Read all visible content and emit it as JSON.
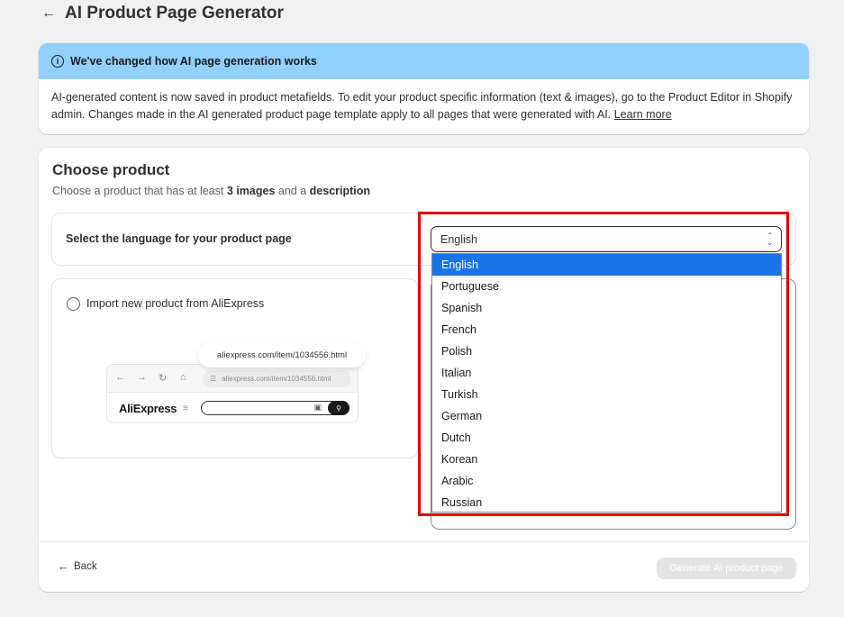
{
  "header": {
    "back_icon": "arrow-left-icon",
    "title": "AI Product Page Generator"
  },
  "banner": {
    "title": "We've changed how AI page generation works",
    "body": "AI-generated content is now saved in product metafields. To edit your product specific information (text & images), go to the Product Editor in Shopify admin. Changes made in the AI generated product page template apply to all pages that were generated with AI.",
    "link": "Learn more",
    "color": "#91d0ff"
  },
  "card": {
    "title": "Choose product",
    "subtitle_prefix": "Choose a product that has at least",
    "subtitle_bold1": "3 images",
    "subtitle_mid": "and a",
    "subtitle_bold2": "description"
  },
  "language": {
    "label": "Select the language for your product page",
    "selected": "English",
    "options": [
      "English",
      "Portuguese",
      "Spanish",
      "French",
      "Polish",
      "Italian",
      "Turkish",
      "German",
      "Dutch",
      "Korean",
      "Arabic",
      "Russian"
    ]
  },
  "import": {
    "label": "Import new product from AliExpress",
    "tooltip_url": "aliexpress.com/item/1034556.html",
    "bar_url": "aliexpress.com/item/1034556.html",
    "logo_text": "AliExpress"
  },
  "footer": {
    "back_label": "Back",
    "generate_label": "Generate AI product page"
  },
  "colors": {
    "highlight": "#e00000",
    "selected_option": "#1a73e8",
    "disabled_button": "#e3e3e3"
  }
}
